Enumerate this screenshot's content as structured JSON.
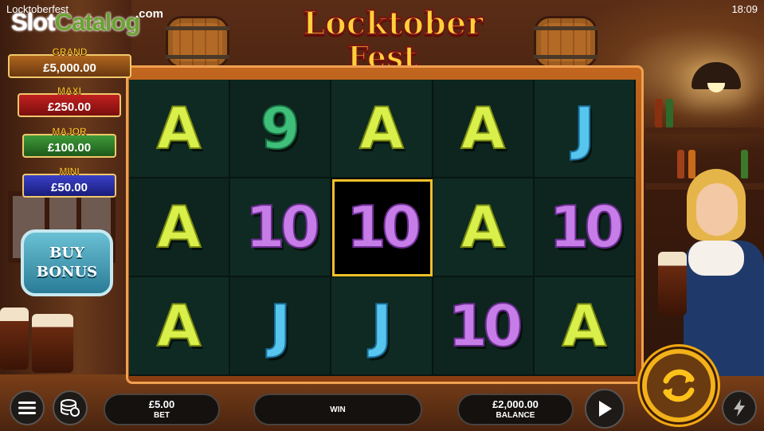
{
  "status_bar": {
    "title": "Locktoberfest",
    "time": "18:09"
  },
  "watermark": {
    "part1": "Slot",
    "part2": "Catalog",
    "suffix": ".com"
  },
  "logo": {
    "line1": "Locktober",
    "line2": "Fest"
  },
  "jackpots": [
    {
      "name": "GRAND",
      "value": "£5,000.00"
    },
    {
      "name": "MAXI",
      "value": "£250.00"
    },
    {
      "name": "MAJOR",
      "value": "£100.00"
    },
    {
      "name": "MINI",
      "value": "£50.00"
    }
  ],
  "buy_bonus": {
    "line1": "BUY",
    "line2": "BONUS"
  },
  "reels": {
    "rows": [
      [
        "A",
        "9",
        "A",
        "A",
        "J"
      ],
      [
        "A",
        "10",
        "10",
        "A",
        "10"
      ],
      [
        "A",
        "J",
        "J",
        "10",
        "A"
      ]
    ],
    "highlighted": {
      "row": 1,
      "col": 2
    }
  },
  "bottom_bar": {
    "bet_value": "£5.00",
    "bet_label": "BET",
    "win_value": "",
    "win_label": "WIN",
    "balance_value": "£2,000.00",
    "balance_label": "BALANCE"
  },
  "icons": {
    "menu": "hamburger-menu-icon",
    "coins": "coin-stack-icon",
    "play": "play-icon",
    "spin": "spin-arrows-icon",
    "turbo": "lightning-icon"
  },
  "colors": {
    "symbol_A": "#d9f04a",
    "symbol_9": "#3fbf7a",
    "symbol_J": "#57c6ee",
    "symbol_10": "#c77de8",
    "highlight": "#f5c12a",
    "spin_gold": "#f3b21a"
  }
}
